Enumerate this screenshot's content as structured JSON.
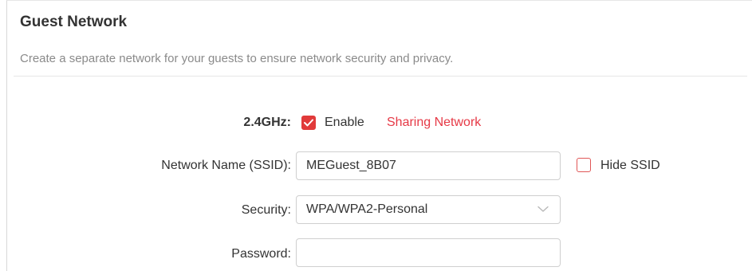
{
  "section": {
    "title": "Guest Network",
    "description": "Create a separate network for your guests to ensure network security and privacy."
  },
  "band": {
    "label": "2.4GHz:",
    "enable_checked": true,
    "enable_label": "Enable",
    "sharing_link": "Sharing Network"
  },
  "ssid": {
    "label": "Network Name (SSID):",
    "value": "MEGuest_8B07",
    "hide_checked": false,
    "hide_label": "Hide SSID"
  },
  "security": {
    "label": "Security:",
    "value": "WPA/WPA2-Personal",
    "icon": "chevron-down-icon"
  },
  "password": {
    "label": "Password:",
    "value": ""
  },
  "colors": {
    "accent": "#e13a3a",
    "link": "#e63946",
    "muted_text": "#8a8a8a",
    "border": "#cfcfcf"
  }
}
